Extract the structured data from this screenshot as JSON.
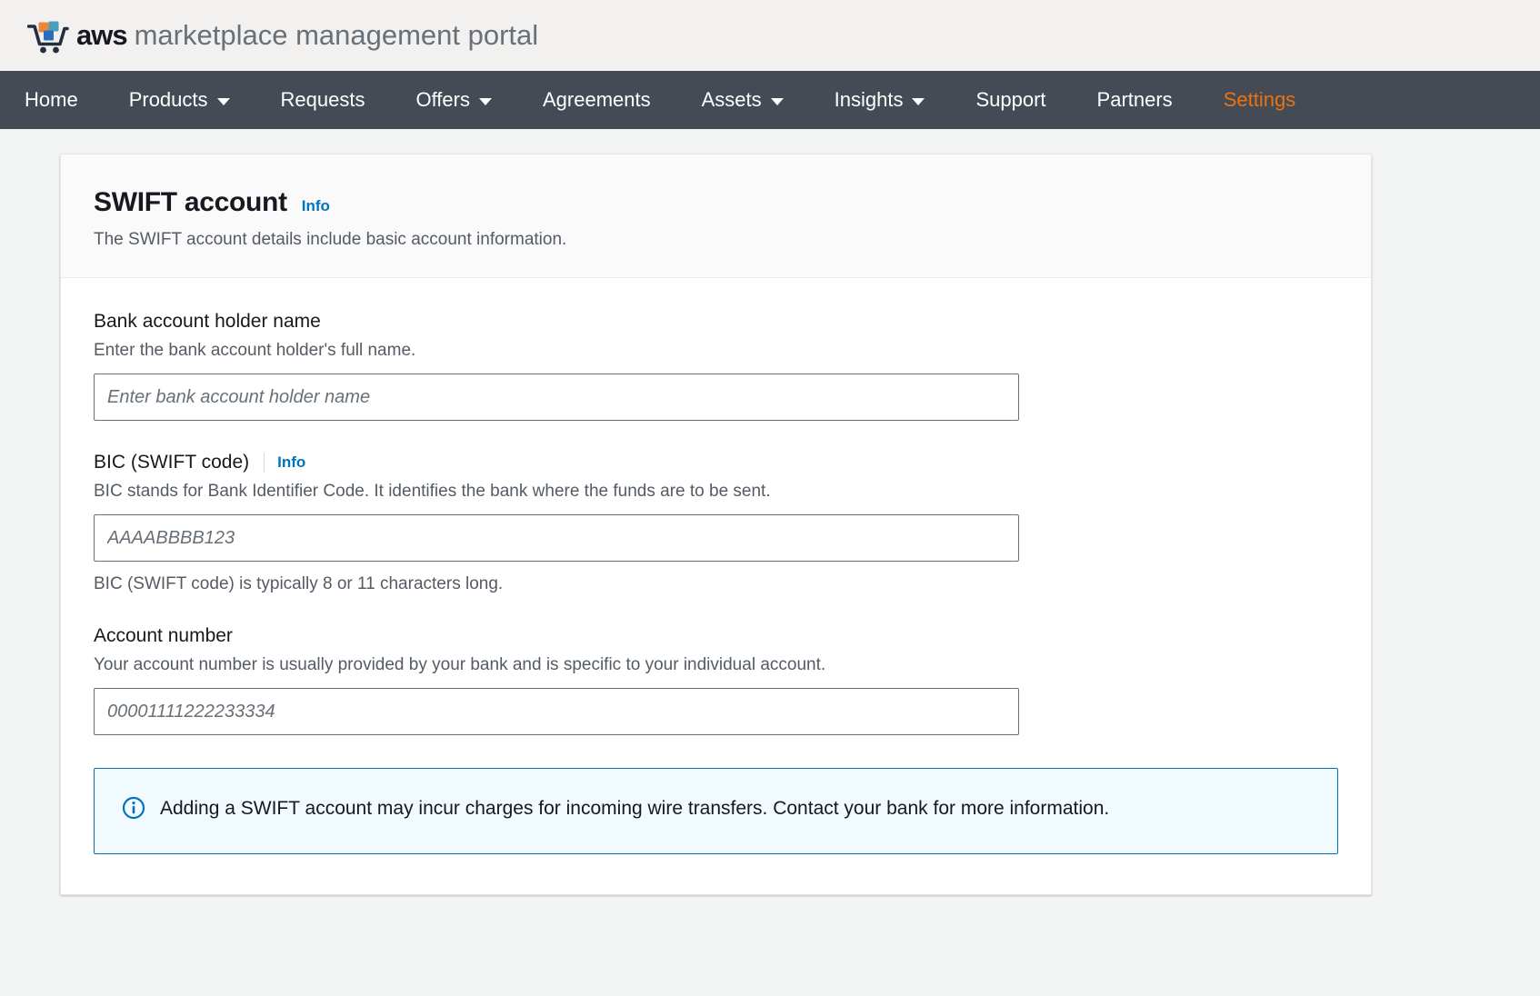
{
  "brand": {
    "logo_icon": "shopping-cart-icon",
    "name_bold": "aws",
    "name_rest": "marketplace management portal",
    "logo_colors": {
      "cart": "#232f3e",
      "cube_orange": "#e8883a",
      "cube_teal": "#4a9fbb",
      "cube_blue": "#2a6ebb"
    }
  },
  "nav": {
    "background": "#444b55",
    "active_color": "#ec7211",
    "items": [
      {
        "label": "Home",
        "has_caret": false,
        "active": false
      },
      {
        "label": "Products",
        "has_caret": true,
        "active": false
      },
      {
        "label": "Requests",
        "has_caret": false,
        "active": false
      },
      {
        "label": "Offers",
        "has_caret": true,
        "active": false
      },
      {
        "label": "Agreements",
        "has_caret": false,
        "active": false
      },
      {
        "label": "Assets",
        "has_caret": true,
        "active": false
      },
      {
        "label": "Insights",
        "has_caret": true,
        "active": false
      },
      {
        "label": "Support",
        "has_caret": false,
        "active": false
      },
      {
        "label": "Partners",
        "has_caret": false,
        "active": false
      },
      {
        "label": "Settings",
        "has_caret": false,
        "active": true
      }
    ]
  },
  "card": {
    "title": "SWIFT account",
    "info_label": "Info",
    "subtitle": "The SWIFT account details include basic account information."
  },
  "fields": {
    "holder_name": {
      "label": "Bank account holder name",
      "description": "Enter the bank account holder's full name.",
      "placeholder": "Enter bank account holder name",
      "value": ""
    },
    "bic": {
      "label": "BIC (SWIFT code)",
      "info_label": "Info",
      "description": "BIC stands for Bank Identifier Code. It identifies the bank where the funds are to be sent.",
      "placeholder": "AAAABBBB123",
      "value": "",
      "hint": "BIC (SWIFT code) is typically 8 or 11 characters long."
    },
    "account_number": {
      "label": "Account number",
      "description": "Your account number is usually provided by your bank and is specific to your individual account.",
      "placeholder": "00001111222233334",
      "value": ""
    }
  },
  "alert": {
    "icon": "info-circle-icon",
    "accent_color": "#0073bb",
    "background": "#f1faff",
    "text": "Adding a SWIFT account may incur charges for incoming wire transfers. Contact your bank for more information."
  }
}
